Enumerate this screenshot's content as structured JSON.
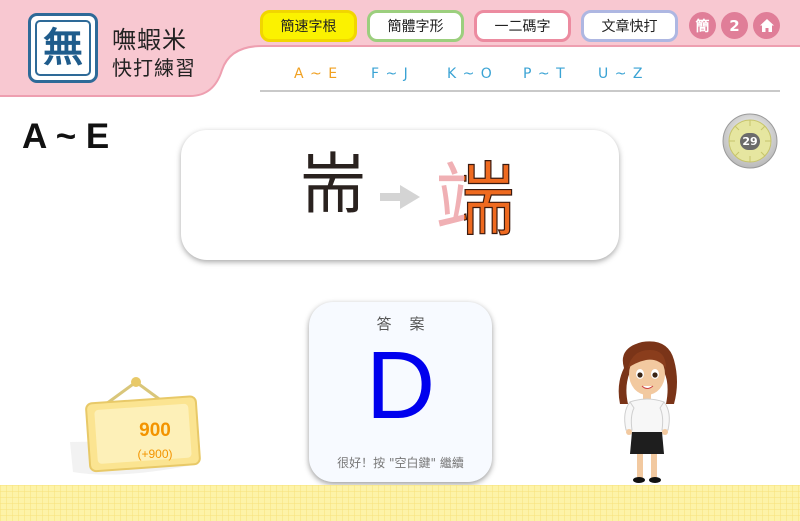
{
  "app": {
    "logo_glyph": "無",
    "name": "嘸蝦米",
    "subtitle": "快打練習"
  },
  "top_nav": {
    "buttons": [
      "簡速字根",
      "簡體字形",
      "一二碼字",
      "文章快打"
    ],
    "active_index": 0,
    "simplified_label": "簡",
    "count_label": "2",
    "home_icon": "home-icon"
  },
  "range_tabs": [
    "A ~ E",
    "F ~ J",
    "K ~ O",
    "P ~ T",
    "U ~ Z"
  ],
  "active_range": 0,
  "level": {
    "title": "A ~ E"
  },
  "timer": {
    "value": "29"
  },
  "question": {
    "component": "耑",
    "target": "端"
  },
  "answer": {
    "label": "答案",
    "letter": "D",
    "hint": "很好！按 \"空白鍵\" 繼續"
  },
  "score": {
    "value": "900",
    "bonus": "(+900)"
  },
  "colors": {
    "header_pink": "#f7c5cf",
    "accent_orange": "#f39400",
    "active_tab": "#f0a020",
    "tab_blue": "#3aa3d4",
    "answer_blue": "#0000ee",
    "strip_yellow": "#fdf3a8"
  }
}
